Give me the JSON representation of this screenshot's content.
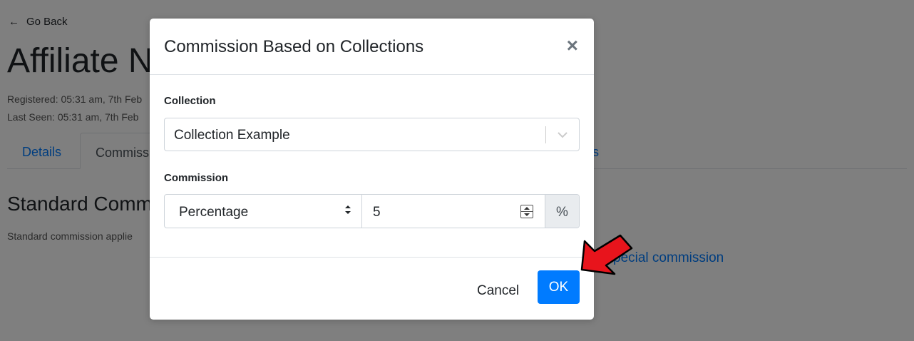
{
  "background": {
    "go_back": "Go Back",
    "page_title": "Affiliate N",
    "registered": "Registered: 05:31 am, 7th Feb",
    "last_seen": "Last Seen: 05:31 am, 7th Feb",
    "tabs": [
      "Details",
      "Commiss",
      "s"
    ],
    "section_title": "Standard Comm",
    "section_desc": "Standard commission applie",
    "special_link": "pecial commission"
  },
  "modal": {
    "title": "Commission Based on Collections",
    "close_symbol": "×",
    "collection_label": "Collection",
    "collection_value": "Collection Example",
    "commission_label": "Commission",
    "commission_type": "Percentage",
    "commission_amount": "5",
    "commission_unit": "%",
    "cancel_label": "Cancel",
    "ok_label": "OK"
  },
  "colors": {
    "primary": "#007bff",
    "annotation_arrow": "#e8141c"
  }
}
